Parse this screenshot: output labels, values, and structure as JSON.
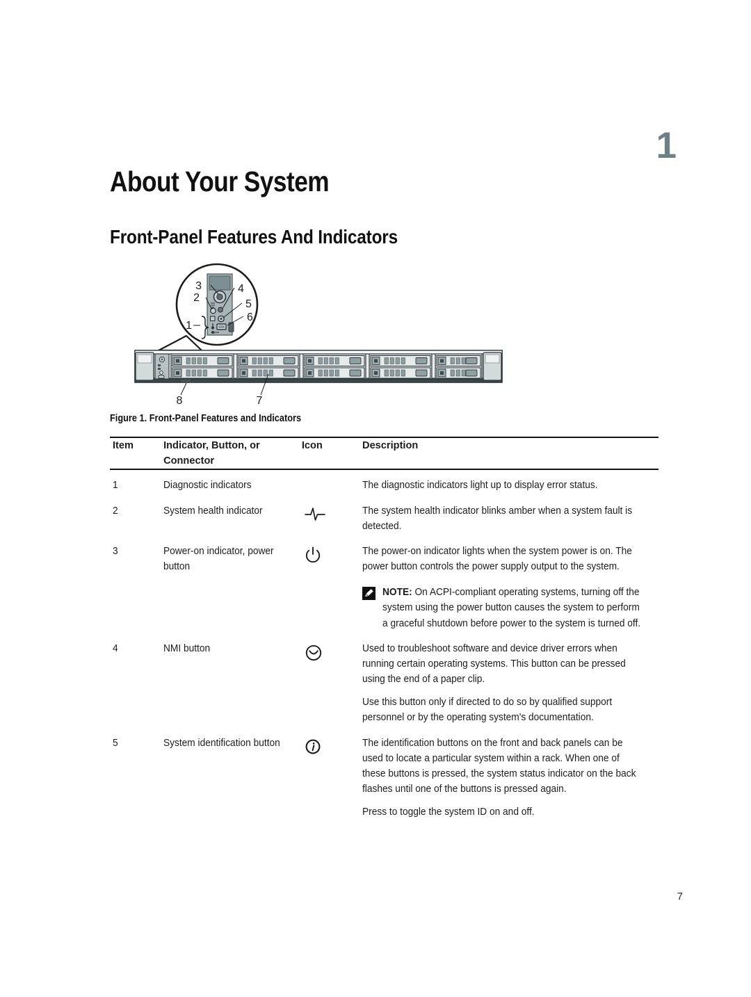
{
  "document": {
    "chapter_number": "1",
    "chapter_title": "About Your System",
    "section_title": "Front-Panel Features And Indicators",
    "page_number": "7",
    "chapter_number_color": "#6b8183"
  },
  "figure": {
    "caption": "Figure 1. Front-Panel Features and Indicators",
    "callouts": {
      "c1": "1",
      "c2": "2",
      "c3": "3",
      "c4": "4",
      "c5": "5",
      "c6": "6",
      "c7": "7",
      "c8": "8"
    }
  },
  "table": {
    "headers": {
      "item": "Item",
      "name": "Indicator, Button, or Connector",
      "icon": "Icon",
      "description": "Description"
    },
    "rows": [
      {
        "item": "1",
        "name": "Diagnostic indicators",
        "icon": "",
        "paragraphs": [
          "The diagnostic indicators light up to display error status."
        ]
      },
      {
        "item": "2",
        "name": "System health indicator",
        "icon": "health-pulse-icon",
        "paragraphs": [
          "The system health indicator blinks amber when a system fault is detected."
        ]
      },
      {
        "item": "3",
        "name": "Power-on indicator, power button",
        "icon": "power-icon",
        "paragraphs": [
          "The power-on indicator lights when the system power is on. The power button controls the power supply output to the system."
        ],
        "note": {
          "label": "NOTE:",
          "text": " On ACPI-compliant operating systems, turning off the system using the power button causes the system to perform a graceful shutdown before power to the system is turned off."
        }
      },
      {
        "item": "4",
        "name": "NMI button",
        "icon": "nmi-icon",
        "paragraphs": [
          "Used to troubleshoot software and device driver errors when running certain operating systems. This button can be pressed using the end of a paper clip.",
          "Use this button only if directed to do so by qualified support personnel or by the operating system's documentation."
        ]
      },
      {
        "item": "5",
        "name": "System identification button",
        "icon": "system-id-icon",
        "paragraphs": [
          "The identification buttons on the front and back panels can be used to locate a particular system within a rack. When one of these buttons is pressed, the system status indicator on the back flashes until one of the buttons is pressed again.",
          "Press to toggle the system ID on and off."
        ]
      }
    ]
  }
}
